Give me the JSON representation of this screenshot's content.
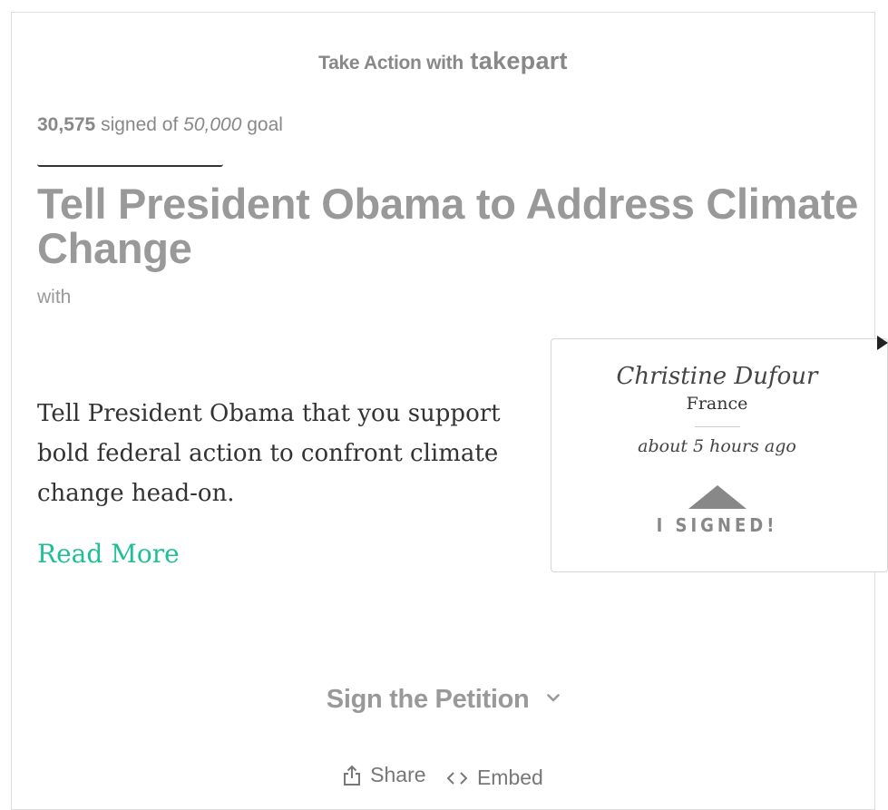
{
  "header": {
    "prefix": "Take Action with",
    "brand": "takepart"
  },
  "progress": {
    "signed_count": "30,575",
    "signed_label": "signed of",
    "goal": "50,000",
    "goal_suffix": "goal",
    "fraction": 0.6115
  },
  "petition": {
    "title": "Tell President Obama to Address Climate Change",
    "with_label": "with",
    "description": "Tell President Obama that you support bold federal action to confront climate change head-on.",
    "read_more": "Read More"
  },
  "recent_signer": {
    "name": "Christine Dufour",
    "country": "France",
    "time": "about 5 hours ago",
    "badge": "I SIGNED!"
  },
  "cta": {
    "sign_label": "Sign the Petition"
  },
  "footer": {
    "share_label": "Share",
    "embed_label": "Embed"
  }
}
